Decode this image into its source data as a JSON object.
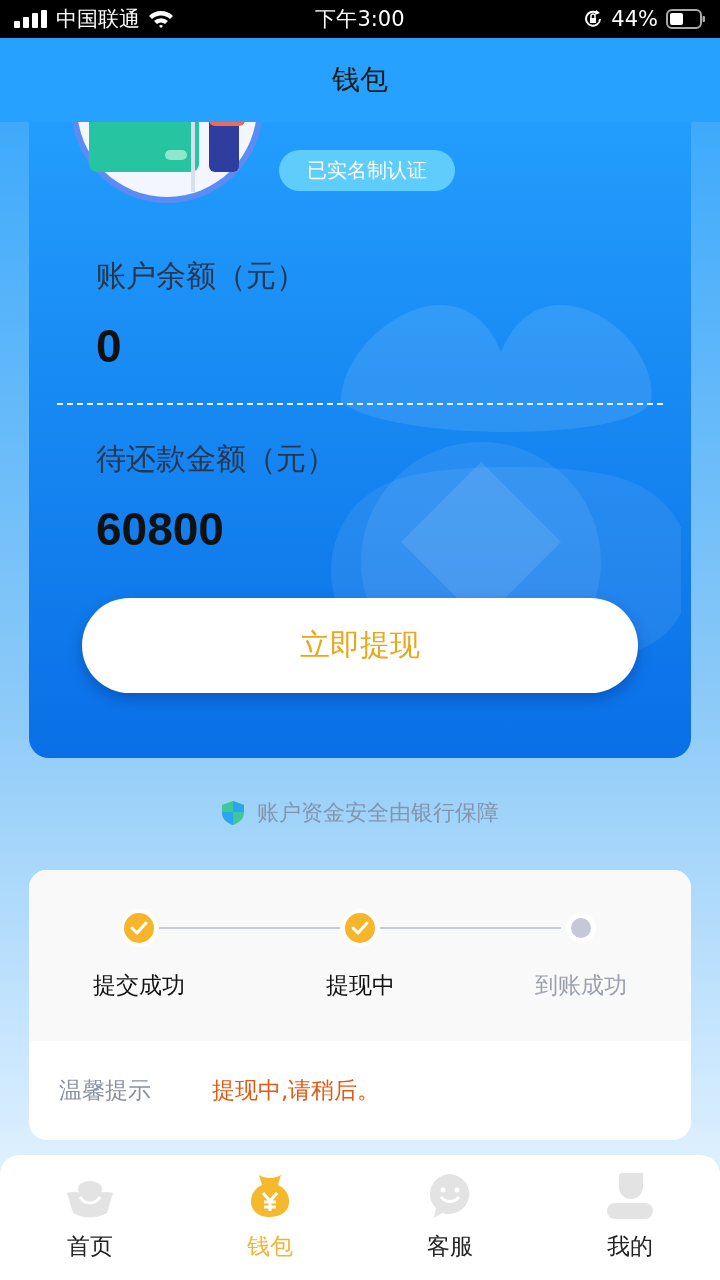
{
  "status_bar": {
    "carrier": "中国联通",
    "time": "下午3:00",
    "battery": "44%"
  },
  "header": {
    "title": "钱包"
  },
  "wallet_card": {
    "badge": "已实名制认证",
    "balance_label": "账户余额（元）",
    "balance": "0",
    "pending_label": "待还款金额（元）",
    "pending": "60800",
    "button": "立即提现"
  },
  "security_note": "账户资金安全由银行保障",
  "progress": {
    "steps": [
      {
        "label": "提交成功",
        "done": true
      },
      {
        "label": "提现中",
        "done": true
      },
      {
        "label": "到账成功",
        "done": false
      }
    ],
    "tip_label": "温馨提示",
    "tip_text": "提现中,请稍后。"
  },
  "tab_bar": [
    {
      "label": "首页",
      "selected": false
    },
    {
      "label": "钱包",
      "selected": true
    },
    {
      "label": "客服",
      "selected": false
    },
    {
      "label": "我的",
      "selected": false
    }
  ]
}
